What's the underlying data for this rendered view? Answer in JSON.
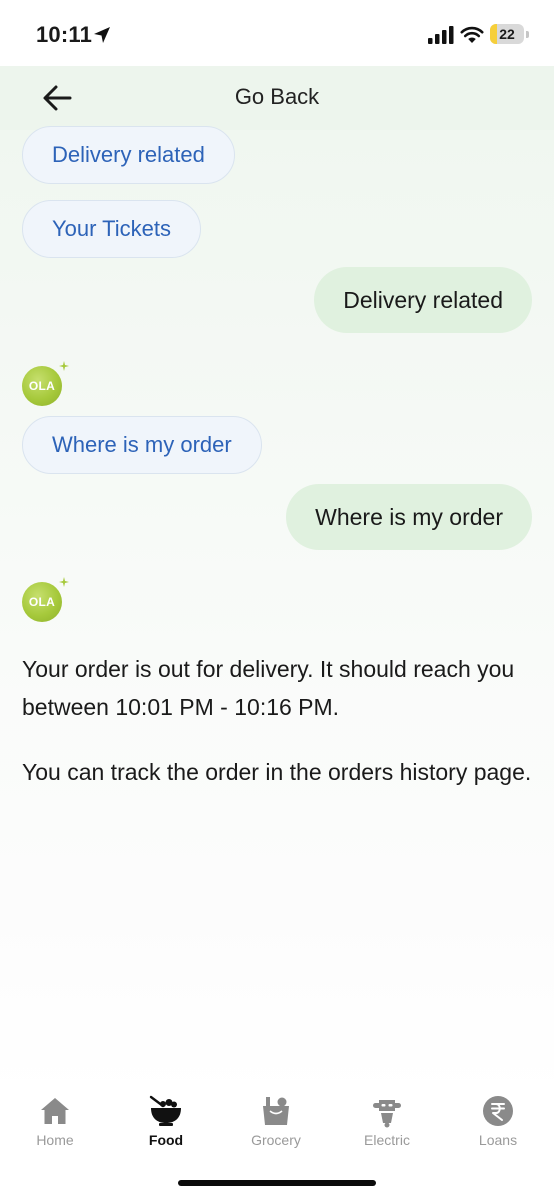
{
  "status_bar": {
    "time": "10:11",
    "battery_level": "22",
    "battery_fraction": 0.22,
    "icons": [
      "location-arrow-icon",
      "signal-icon",
      "wifi-icon",
      "battery-icon"
    ]
  },
  "header": {
    "title": "Go Back",
    "back_icon": "arrow-left-icon"
  },
  "chat": {
    "chip_delivery_related": "Delivery related",
    "chip_your_tickets": "Your Tickets",
    "user_message_1": "Delivery related",
    "bot_avatar_1": "OLA",
    "chip_where_is_my_order": "Where is my order",
    "user_message_2": "Where is my order",
    "bot_avatar_2": "OLA",
    "bot_message_1": "Your order is out for delivery. It should reach you between 10:01 PM - 10:16 PM.",
    "bot_message_2": "You can track the order in the orders history page."
  },
  "bottom_nav": {
    "active": "Food",
    "items": [
      {
        "label": "Home",
        "icon": "home-icon"
      },
      {
        "label": "Food",
        "icon": "food-bowl-icon"
      },
      {
        "label": "Grocery",
        "icon": "grocery-bag-icon"
      },
      {
        "label": "Electric",
        "icon": "electric-scooter-icon"
      },
      {
        "label": "Loans",
        "icon": "rupee-icon"
      }
    ]
  },
  "colors": {
    "chip_text": "#2d63b8",
    "chip_bg": "#f0f5fb",
    "user_bubble_bg": "#e0f1df",
    "header_bg": "#edf5ed",
    "avatar_green": "#a6c93b",
    "battery_yellow": "#f6cf3a"
  }
}
